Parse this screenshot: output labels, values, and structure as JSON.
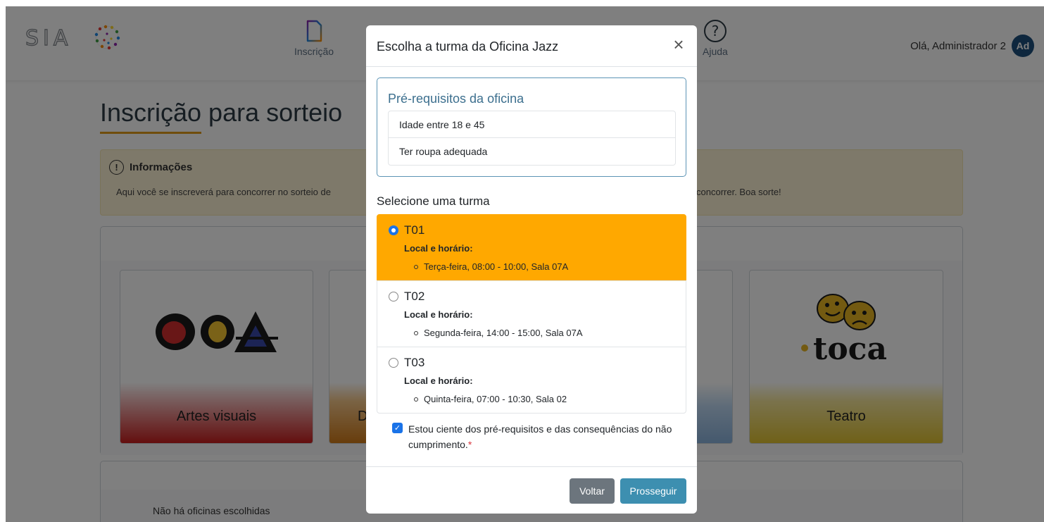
{
  "navbar": {
    "items": [
      {
        "label": "Inscrição",
        "icon": "document-icon"
      },
      {
        "label": "Ajuda",
        "icon": "question-circle-icon"
      }
    ],
    "greeting": "Olá, Administrador 2",
    "avatar_initials": "Ad"
  },
  "page": {
    "title": "Inscrição para sorteio",
    "info_heading": "Informações",
    "info_text_left": "Aqui você se inscreverá para concorrer no sorteio de",
    "info_text_right": "concorrer. Boa sorte!",
    "cards": [
      {
        "label": "Artes visuais",
        "logo_text": "OCA"
      },
      {
        "label": "D"
      },
      {
        "label": ""
      },
      {
        "label": "Teatro",
        "logo_text": "toca"
      }
    ],
    "empty_workshops": "Não há oficinas escolhidas"
  },
  "modal": {
    "title": "Escolha a turma da Oficina Jazz",
    "prereq_title": "Pré-requisitos da oficina",
    "prereqs": [
      "Idade entre 18 e 45",
      "Ter roupa adequada"
    ],
    "select_label": "Selecione uma turma",
    "turmas": [
      {
        "name": "T01",
        "sub": "Local e horário:",
        "detail": "Terça-feira, 08:00 - 10:00, Sala 07A",
        "selected": true
      },
      {
        "name": "T02",
        "sub": "Local e horário:",
        "detail": "Segunda-feira, 14:00 - 15:00, Sala 07A",
        "selected": false
      },
      {
        "name": "T03",
        "sub": "Local e horário:",
        "detail": "Quinta-feira, 07:00 - 10:30, Sala 02",
        "selected": false
      }
    ],
    "ack_text": "Estou ciente dos pré-requisitos e das consequências do não cumprimento.",
    "ack_required_mark": "*",
    "ack_checked": true,
    "back_label": "Voltar",
    "next_label": "Prosseguir"
  },
  "colors": {
    "selected_turma": "#ffa800",
    "primary_button": "#3d8fb0",
    "secondary_button": "#6c757d",
    "checkbox": "#1a73e8"
  }
}
